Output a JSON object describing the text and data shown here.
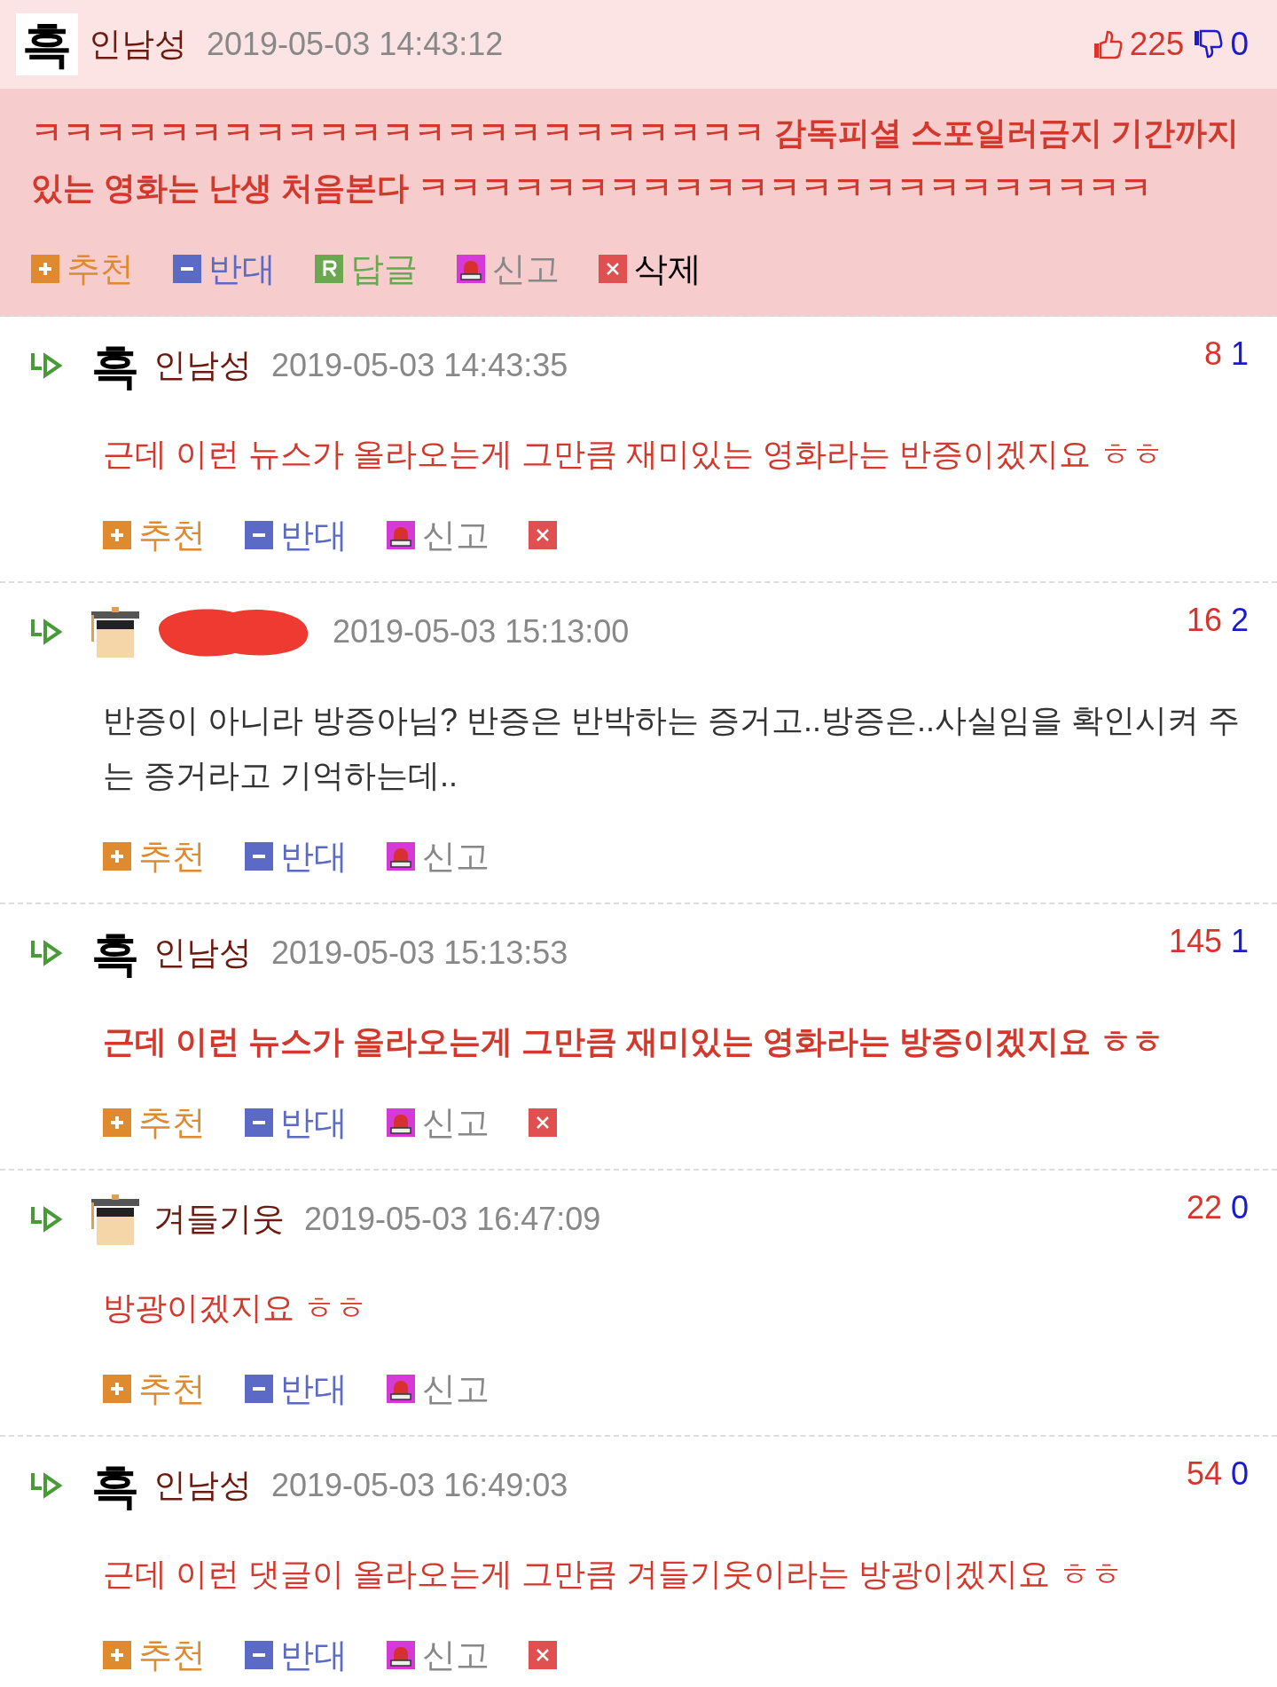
{
  "post": {
    "avatar": {
      "kind": "text",
      "text": "흑"
    },
    "name": "인남성",
    "time": "2019-05-03 14:43:12",
    "up": "225",
    "down": "0",
    "body": "ㅋㅋㅋㅋㅋㅋㅋㅋㅋㅋㅋㅋㅋㅋㅋㅋㅋㅋㅋㅋㅋㅋㅋ 감독피셜 스포일러금지 기간까지 있는 영화는 난생 처음본다 ㅋㅋㅋㅋㅋㅋㅋㅋㅋㅋㅋㅋㅋㅋㅋㅋㅋㅋㅋㅋㅋㅋㅋ",
    "color": "#d2382c",
    "bold": true,
    "actions": [
      {
        "kind": "recommend",
        "label": "추천"
      },
      {
        "kind": "oppose",
        "label": "반대"
      },
      {
        "kind": "reply",
        "label": "답글"
      },
      {
        "kind": "report",
        "label": "신고"
      },
      {
        "kind": "delete",
        "label": "삭제"
      }
    ]
  },
  "replies": [
    {
      "avatar": {
        "kind": "text",
        "text": "흑"
      },
      "name": "인남성",
      "time": "2019-05-03 14:43:35",
      "up": "8",
      "down": "1",
      "body": "근데 이런 뉴스가 올라오는게 그만큼 재미있는 영화라는 반증이겠지요 ㅎㅎ",
      "color": "#d2382c",
      "bold": false,
      "actions": [
        {
          "kind": "recommend",
          "label": "추천"
        },
        {
          "kind": "oppose",
          "label": "반대"
        },
        {
          "kind": "report",
          "label": "신고"
        },
        {
          "kind": "delete"
        }
      ]
    },
    {
      "avatar": {
        "kind": "figure"
      },
      "redacted": true,
      "time": "2019-05-03 15:13:00",
      "up": "16",
      "down": "2",
      "body": "반증이 아니라 방증아님? 반증은 반박하는 증거고..방증은..사실임을 확인시켜 주는 증거라고 기억하는데..",
      "color": "#333333",
      "bold": false,
      "actions": [
        {
          "kind": "recommend",
          "label": "추천"
        },
        {
          "kind": "oppose",
          "label": "반대"
        },
        {
          "kind": "report",
          "label": "신고"
        }
      ]
    },
    {
      "avatar": {
        "kind": "text",
        "text": "흑"
      },
      "name": "인남성",
      "time": "2019-05-03 15:13:53",
      "up": "145",
      "down": "1",
      "body": "근데 이런 뉴스가 올라오는게 그만큼 재미있는 영화라는 방증이겠지요 ㅎㅎ",
      "color": "#d2382c",
      "bold": true,
      "actions": [
        {
          "kind": "recommend",
          "label": "추천"
        },
        {
          "kind": "oppose",
          "label": "반대"
        },
        {
          "kind": "report",
          "label": "신고"
        },
        {
          "kind": "delete"
        }
      ]
    },
    {
      "avatar": {
        "kind": "figure"
      },
      "name": "겨들기웃",
      "time": "2019-05-03 16:47:09",
      "up": "22",
      "down": "0",
      "body": "방광이겠지요 ㅎㅎ",
      "color": "#d2382c",
      "bold": false,
      "actions": [
        {
          "kind": "recommend",
          "label": "추천"
        },
        {
          "kind": "oppose",
          "label": "반대"
        },
        {
          "kind": "report",
          "label": "신고"
        }
      ]
    },
    {
      "avatar": {
        "kind": "text",
        "text": "흑"
      },
      "name": "인남성",
      "time": "2019-05-03 16:49:03",
      "up": "54",
      "down": "0",
      "body": "근데 이런 댓글이 올라오는게 그만큼 겨들기웃이라는 방광이겠지요 ㅎㅎ",
      "color": "#d2382c",
      "bold": false,
      "actions": [
        {
          "kind": "recommend",
          "label": "추천"
        },
        {
          "kind": "oppose",
          "label": "반대"
        },
        {
          "kind": "report",
          "label": "신고"
        },
        {
          "kind": "delete"
        }
      ]
    }
  ]
}
